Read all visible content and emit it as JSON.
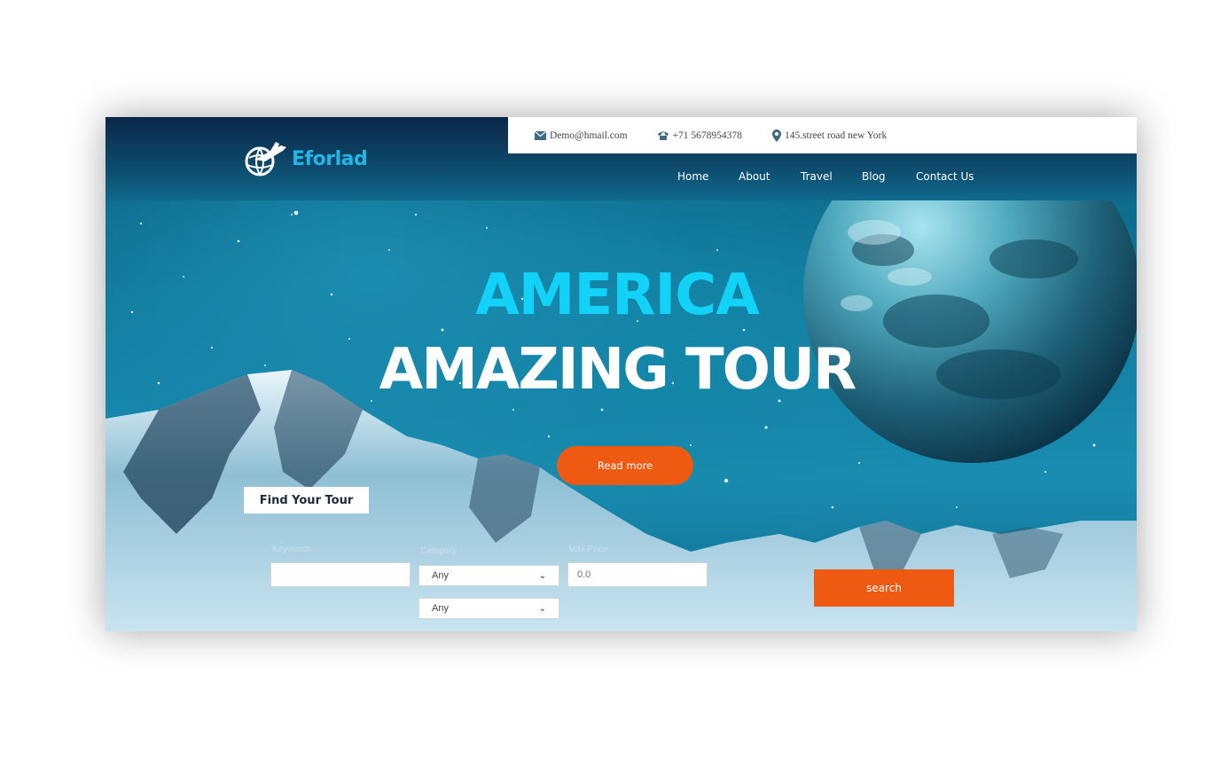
{
  "brand": {
    "name": "Eforlad",
    "accent": "#21b6e3"
  },
  "topbar": {
    "email": "Demo@hmail.com",
    "phone": "+71 5678954378",
    "address": "145.street road new York"
  },
  "nav": {
    "items": [
      {
        "label": "Home"
      },
      {
        "label": "About"
      },
      {
        "label": "Travel"
      },
      {
        "label": "Blog"
      },
      {
        "label": "Contact Us"
      }
    ]
  },
  "hero": {
    "title_line1": "AMERICA",
    "title_line2": "AMAZING TOUR",
    "cta_label": "Read more",
    "cta_color": "#ee5a12"
  },
  "search_form": {
    "heading": "Find Your Tour",
    "keyword": {
      "label": "Keywords",
      "value": ""
    },
    "category": {
      "label": "Category",
      "selected": "Any"
    },
    "duration": {
      "selected": "Any"
    },
    "max_price": {
      "label": "Max Price",
      "placeholder": "0.0"
    },
    "submit_label": "search"
  },
  "icons": {
    "email": "envelope-icon",
    "phone": "phone-icon",
    "address": "map-pin-icon",
    "logo": "plane-globe-icon"
  }
}
